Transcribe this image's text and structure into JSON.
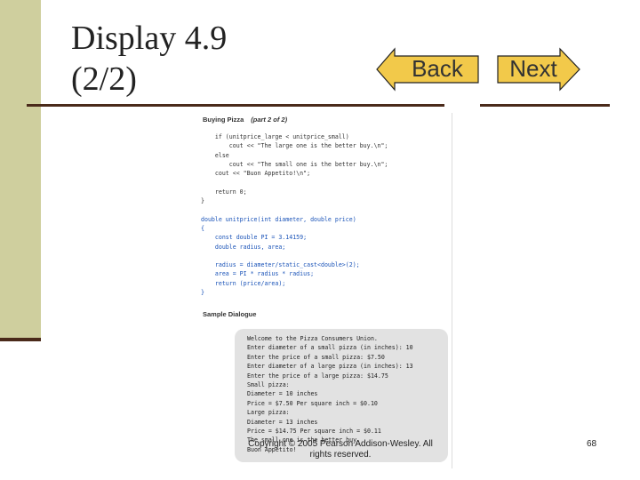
{
  "slide": {
    "title_line1": "Display 4.9",
    "title_line2": "(2/2)",
    "back_label": "Back",
    "next_label": "Next",
    "copyright": "Copyright © 2005 Pearson Addison-Wesley. All rights reserved.",
    "page_number": "68"
  },
  "listing": {
    "header": "Buying Pizza",
    "header_part": "(part 2 of 2)",
    "code": [
      {
        "text": "    if (unitprice_large < unitprice_small)"
      },
      {
        "text": "        cout << \"The large one is the better buy.\\n\";"
      },
      {
        "text": "    else"
      },
      {
        "text": "        cout << \"The small one is the better buy.\\n\";"
      },
      {
        "text": "    cout << \"Buon Appetito!\\n\";"
      },
      {
        "text": ""
      },
      {
        "text": "    return 0;"
      },
      {
        "text": "}"
      },
      {
        "text": ""
      },
      {
        "text": "double unitprice(int diameter, double price)",
        "blue": true
      },
      {
        "text": "{",
        "blue": true
      },
      {
        "text": "    const double PI = 3.14159;",
        "blue": true
      },
      {
        "text": "    double radius, area;",
        "blue": true
      },
      {
        "text": "",
        "blue": true
      },
      {
        "text": "    radius = diameter/static_cast<double>(2);",
        "blue": true
      },
      {
        "text": "    area = PI * radius * radius;",
        "blue": true
      },
      {
        "text": "    return (price/area);",
        "blue": true
      },
      {
        "text": "}",
        "blue": true
      }
    ],
    "dialogue_header": "Sample Dialogue",
    "dialogue": [
      "Welcome to the Pizza Consumers Union.",
      "Enter diameter of a small pizza (in inches): 10",
      "Enter the price of a small pizza: $7.50",
      "Enter diameter of a large pizza (in inches): 13",
      "Enter the price of a large pizza: $14.75",
      "Small pizza:",
      "Diameter = 10 inches",
      "Price = $7.50 Per square inch = $0.10",
      "Large pizza:",
      "Diameter = 13 inches",
      "Price = $14.75 Per square inch = $0.11",
      "The small one is the better buy.",
      "Buon Appetito!"
    ]
  },
  "colors": {
    "accent_bar": "#cfcf9e",
    "nav_arrow_fill": "#f2c94a",
    "rule": "#4a2a1a",
    "code_blue": "#1a53b8"
  }
}
